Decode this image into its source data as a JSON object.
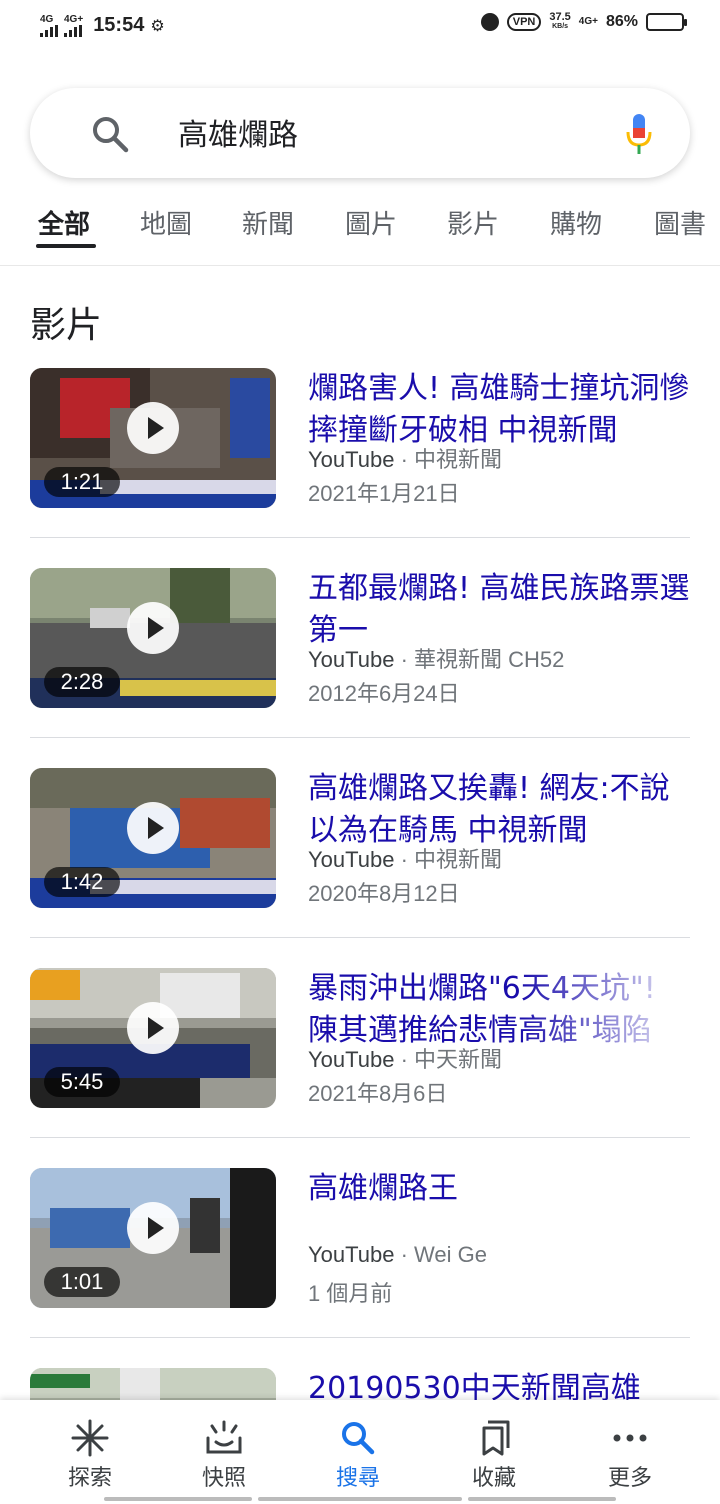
{
  "status_bar": {
    "network_1": "4G",
    "network_2": "4G+",
    "time": "15:54",
    "vpn": "VPN",
    "speed_value": "37.5",
    "speed_unit": "KB/s",
    "network_3": "4G+",
    "battery_percent": "86%",
    "battery_level": 0.86
  },
  "search": {
    "query": "高雄爛路"
  },
  "tabs": [
    {
      "label": "全部",
      "active": true
    },
    {
      "label": "地圖"
    },
    {
      "label": "新聞"
    },
    {
      "label": "圖片"
    },
    {
      "label": "影片"
    },
    {
      "label": "購物"
    },
    {
      "label": "圖書"
    }
  ],
  "section_title": "影片",
  "videos": [
    {
      "title": "爛路害人! 高雄騎士撞坑洞慘摔撞斷牙破相 中視新聞",
      "source": "YouTube",
      "channel": "中視新聞",
      "date": "2021年1月21日",
      "duration": "1:21"
    },
    {
      "title": "五都最爛路! 高雄民族路票選第一",
      "source": "YouTube",
      "channel": "華視新聞 CH52",
      "date": "2012年6月24日",
      "duration": "2:28"
    },
    {
      "title": "高雄爛路又挨轟! 網友:不說以為在騎馬 中視新聞",
      "source": "YouTube",
      "channel": "中視新聞",
      "date": "2020年8月12日",
      "duration": "1:42"
    },
    {
      "title": "暴雨沖出爛路\"6天4天坑\"! 陳其邁推給悲情高雄\"塌陷",
      "source": "YouTube",
      "channel": "中天新聞",
      "date": "2021年8月6日",
      "duration": "5:45"
    },
    {
      "title": "高雄爛路王",
      "source": "YouTube",
      "channel": "Wei Ge",
      "date": "1 個月前",
      "duration": "1:01"
    },
    {
      "title": "20190530中天新聞高雄",
      "source": "",
      "channel": "",
      "date": "",
      "duration": ""
    }
  ],
  "bottom_nav": [
    {
      "label": "探索",
      "icon": "asterisk-icon"
    },
    {
      "label": "快照",
      "icon": "snapshot-icon"
    },
    {
      "label": "搜尋",
      "icon": "search-icon",
      "active": true
    },
    {
      "label": "收藏",
      "icon": "bookmarks-icon"
    },
    {
      "label": "更多",
      "icon": "more-icon"
    }
  ],
  "colors": {
    "link": "#1a0dab",
    "accent": "#1a73e8"
  }
}
